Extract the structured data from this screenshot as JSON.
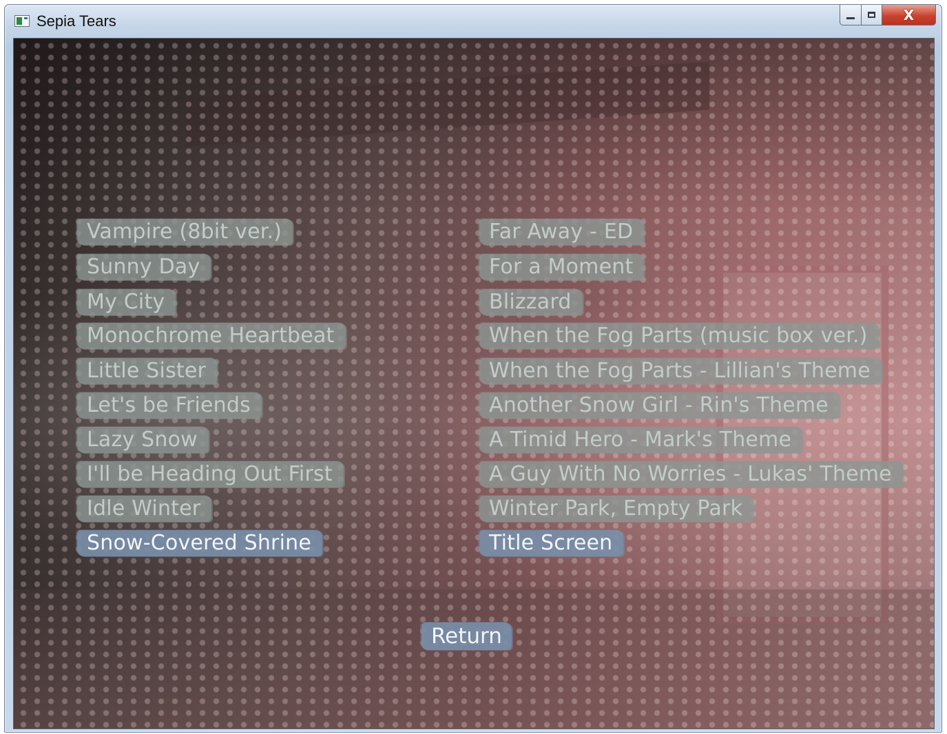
{
  "window": {
    "title": "Sepia Tears",
    "controls": {
      "minimize_icon": "minimize-icon",
      "maximize_icon": "maximize-icon",
      "close_glyph": "X"
    }
  },
  "music_room": {
    "left_column": [
      {
        "label": "Vampire (8bit ver.)",
        "active": false
      },
      {
        "label": "Sunny Day",
        "active": false
      },
      {
        "label": "My City",
        "active": false
      },
      {
        "label": "Monochrome Heartbeat",
        "active": false
      },
      {
        "label": "Little Sister",
        "active": false
      },
      {
        "label": "Let's be Friends",
        "active": false
      },
      {
        "label": "Lazy Snow",
        "active": false
      },
      {
        "label": "I'll be Heading Out First",
        "active": false
      },
      {
        "label": "Idle Winter",
        "active": false
      },
      {
        "label": "Snow-Covered Shrine",
        "active": true
      }
    ],
    "right_column": [
      {
        "label": "Far Away - ED",
        "active": false
      },
      {
        "label": "For a Moment",
        "active": false
      },
      {
        "label": "Blizzard",
        "active": false
      },
      {
        "label": "When the Fog Parts (music box ver.)",
        "active": false
      },
      {
        "label": "When the Fog Parts - Lillian's Theme",
        "active": false
      },
      {
        "label": "Another Snow Girl - Rin's Theme",
        "active": false
      },
      {
        "label": "A Timid Hero - Mark's Theme",
        "active": false
      },
      {
        "label": "A Guy With No Worries - Lukas' Theme",
        "active": false
      },
      {
        "label": "Winter Park, Empty Park",
        "active": false
      },
      {
        "label": "Title Screen",
        "active": true
      }
    ],
    "return_label": "Return"
  },
  "colors": {
    "inactive_button": "#8c9692",
    "active_button": "#788ea8",
    "inactive_text": "#c3ccc8",
    "active_text": "#f2f5f8"
  }
}
